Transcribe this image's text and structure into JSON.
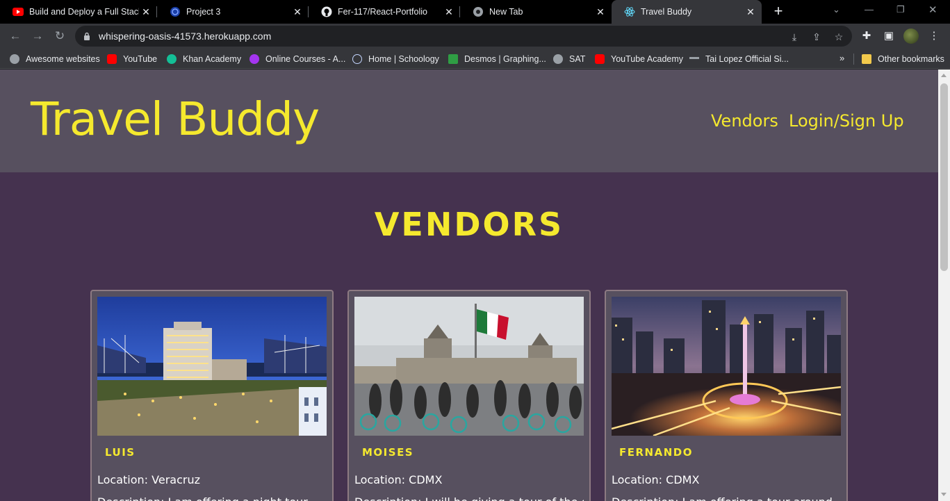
{
  "browser": {
    "tabs": [
      {
        "title": "Build and Deploy a Full Stack",
        "icon": "youtube-icon"
      },
      {
        "title": "Project 3",
        "icon": "globe-icon"
      },
      {
        "title": "Fer-117/React-Portfolio",
        "icon": "github-icon"
      },
      {
        "title": "New Tab",
        "icon": "chrome-icon"
      },
      {
        "title": "Travel Buddy",
        "icon": "react-icon"
      }
    ],
    "url": "whispering-oasis-41573.herokuapp.com",
    "bookmarks": [
      {
        "label": "Awesome websites",
        "icon": "globe-icon"
      },
      {
        "label": "YouTube",
        "icon": "youtube-icon"
      },
      {
        "label": "Khan Academy",
        "icon": "khan-academy-icon"
      },
      {
        "label": "Online Courses - A...",
        "icon": "udemy-icon"
      },
      {
        "label": "Home | Schoology",
        "icon": "schoology-icon"
      },
      {
        "label": "Desmos | Graphing...",
        "icon": "desmos-icon"
      },
      {
        "label": "SAT",
        "icon": "globe-icon"
      },
      {
        "label": "YouTube Academy",
        "icon": "youtube-icon"
      },
      {
        "label": "Tai Lopez Official Si...",
        "icon": "glasses-icon"
      }
    ],
    "bookmarks_more": "»",
    "other_bookmarks": "Other bookmarks"
  },
  "site": {
    "brand": "Travel Buddy",
    "nav": [
      "Vendors",
      "Login/Sign Up"
    ],
    "section_title": "VENDORS",
    "vendors": [
      {
        "name": "LUIS",
        "location": "Location: Veracruz",
        "description": "Description: I am offering a night tour"
      },
      {
        "name": "MOISES",
        "location": "Location: CDMX",
        "description": "Description: I will be giving a tour of the city"
      },
      {
        "name": "FERNANDO",
        "location": "Location: CDMX",
        "description": "Description: I am offering a tour around"
      }
    ]
  },
  "colors": {
    "accent": "#f5e92e",
    "page_bg": "#45324f",
    "header_bg": "#57505f",
    "card_bg": "#57505f",
    "card_border": "#8d7a82"
  }
}
